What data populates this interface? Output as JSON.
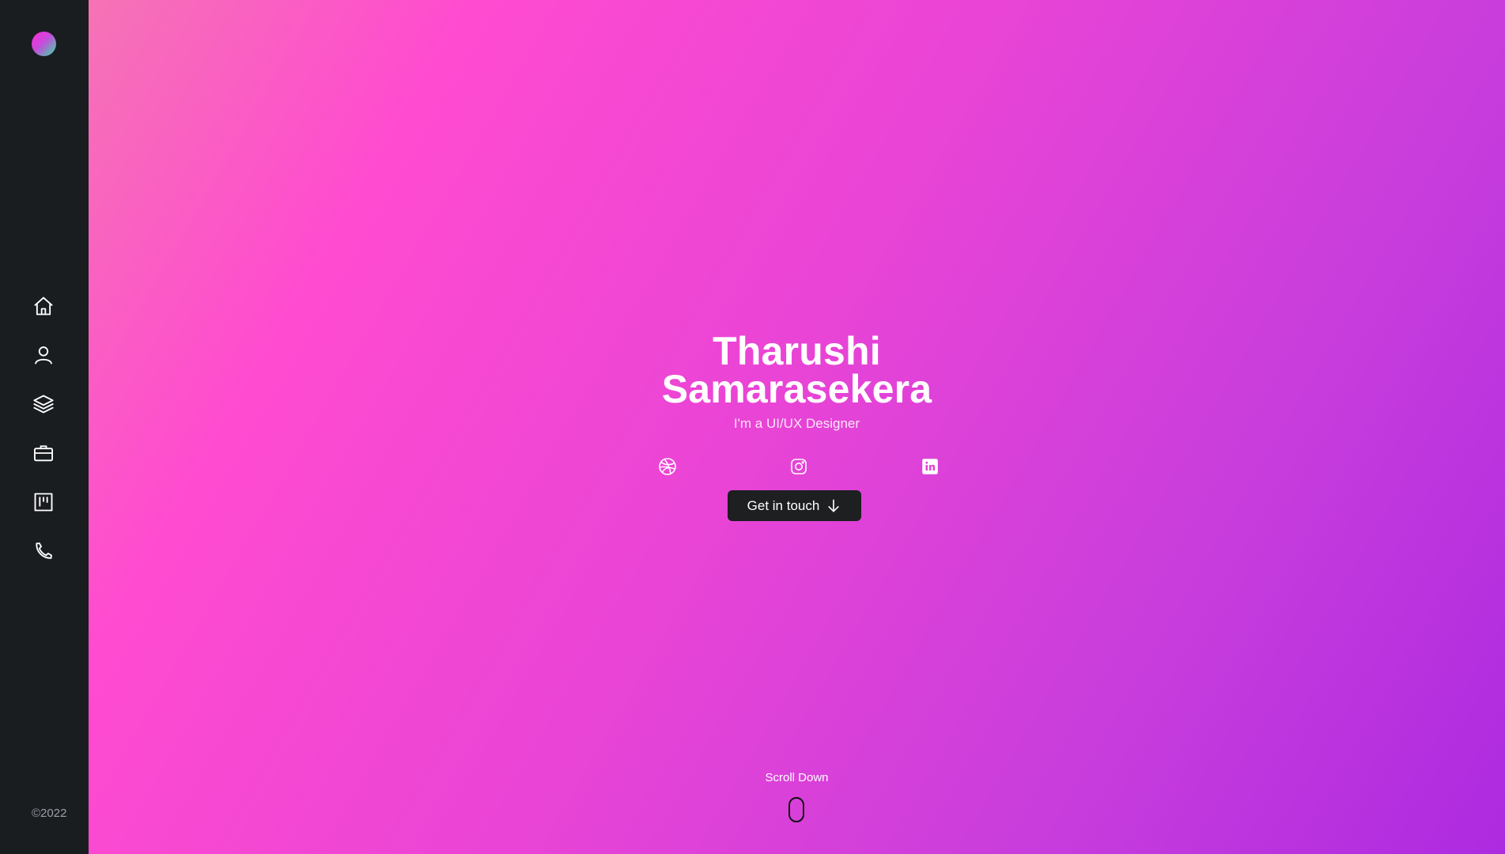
{
  "sidebar": {
    "logo_icon": "gradient-dot-icon",
    "items": [
      {
        "icon": "home-icon"
      },
      {
        "icon": "user-icon"
      },
      {
        "icon": "layers-icon"
      },
      {
        "icon": "briefcase-icon"
      },
      {
        "icon": "board-icon"
      },
      {
        "icon": "phone-icon"
      }
    ],
    "copyright": "©2022"
  },
  "hero": {
    "title_line1": "Tharushi",
    "title_line2": "Samarasekera",
    "subtitle": "I'm a UI/UX Designer",
    "socials": [
      "dribbble-icon",
      "instagram-icon",
      "linkedin-icon"
    ],
    "cta_label": "Get in touch"
  },
  "scroll": {
    "label": "Scroll Down"
  },
  "colors": {
    "sidebar_bg": "#1a1d20",
    "gradient_start": "#f573b5",
    "gradient_mid": "#e944d6",
    "gradient_end": "#ad2ae0",
    "button_bg": "#1d1f21"
  }
}
